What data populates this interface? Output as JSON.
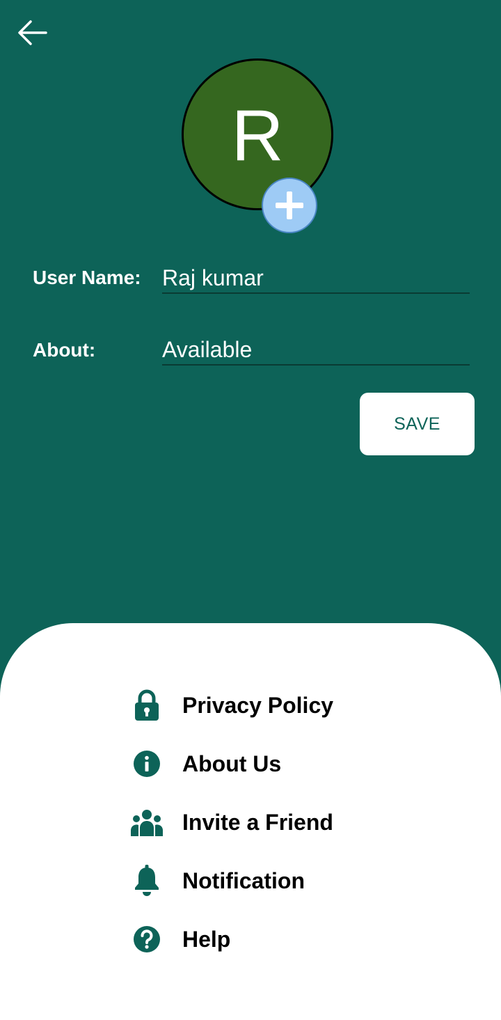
{
  "profile": {
    "avatar_letter": "R",
    "user_name_label": "User Name:",
    "user_name_value": "Raj kumar",
    "about_label": "About:",
    "about_value": "Available",
    "save_label": "SAVE"
  },
  "icons": {
    "back": "back-arrow-icon",
    "add_photo": "plus-icon"
  },
  "menu": {
    "items": [
      {
        "label": "Privacy Policy",
        "icon": "lock-icon"
      },
      {
        "label": "About Us",
        "icon": "info-icon"
      },
      {
        "label": "Invite a Friend",
        "icon": "users-icon"
      },
      {
        "label": "Notification",
        "icon": "bell-icon"
      },
      {
        "label": "Help",
        "icon": "question-icon"
      }
    ]
  },
  "colors": {
    "primary": "#0d6358",
    "avatar_bg": "#35671f",
    "add_button": "#9ecbf5",
    "sheet_bg": "#ffffff"
  }
}
